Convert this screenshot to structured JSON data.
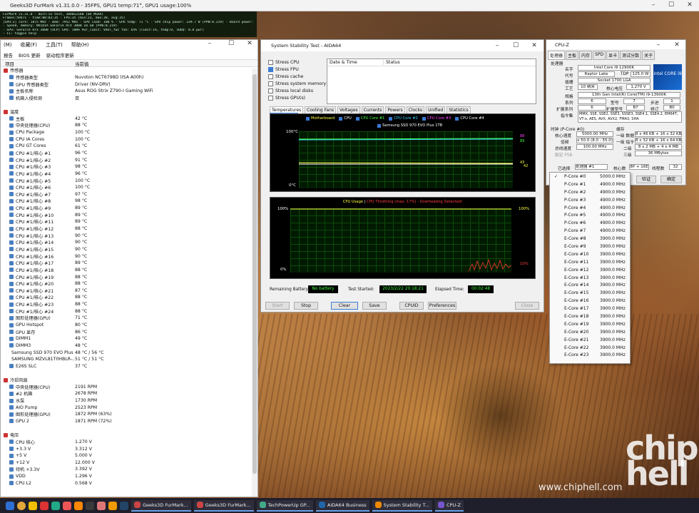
{
  "titlebar": {
    "title": "Geeks3D FurMark v1.31.0.0 - 35FPS, GPU1 temp:71°, GPU1 usage:100%"
  },
  "overlay": {
    "lines": [
      "FurMark v1.31.0 - Burn-in test, 3840x2160 (0X MSAA)",
      "Frames:58471 - time:00:03:35 - FPS:35 (min:23, max:38, avg:35)",
      "[GPU-Z] core: 1875 MHz - mem: 7952 MHz - GPU load: 100 % - GPU temp: 71 °C - GPU chip power: 239.7 W (PPW:0.219) - Board power: 318.4 W (PPW:0.11) - GPU voltage: 0.893 V",
      "- Speed, memory:   NVIDIA GeForce RTX 3080 10 GB (PPW:0.219)",
      "- GPU: GeForce RTX 3080 (OCP) GPU: 100% Pwr_limit: VRel_fwc fan: 65% (limit:1%, temp:0, vDDQ: 0.8 pwr)",
      "- F1: toggle help"
    ]
  },
  "hwinfo": {
    "menu": [
      "(M)",
      "收藏(F)",
      "工具(T)",
      "帮助(H)"
    ],
    "toolbar": [
      "报告",
      "BIOS 更新",
      "驱动程序更新"
    ],
    "col_item": "项目",
    "col_value": "当前值",
    "rows": [
      [
        "传感器",
        ""
      ],
      [
        "传感器类型",
        "Nuvoton NCT6798D (ISA A00h)"
      ],
      [
        "GPU 传感器类型",
        "Driver (NV-DRV)"
      ],
      [
        "主板名称",
        "Asus ROG Strix Z790-I Gaming WiFi"
      ],
      [
        "机箱入侵检测",
        "否"
      ],
      [
        "",
        ""
      ],
      [
        "温度",
        ""
      ],
      [
        "主板",
        "42 °C"
      ],
      [
        "中央处理器(CPU)",
        "88 °C"
      ],
      [
        "CPU Package",
        "100 °C"
      ],
      [
        "CPU IA Cores",
        "100 °C"
      ],
      [
        "CPU GT Cores",
        "61 °C"
      ],
      [
        "CPU #1/核心 #1",
        "96 °C"
      ],
      [
        "CPU #1/核心 #2",
        "91 °C"
      ],
      [
        "CPU #1/核心 #3",
        "98 °C"
      ],
      [
        "CPU #1/核心 #4",
        "96 °C"
      ],
      [
        "CPU #1/核心 #5",
        "100 °C"
      ],
      [
        "CPU #1/核心 #6",
        "100 °C"
      ],
      [
        "CPU #1/核心 #7",
        "97 °C"
      ],
      [
        "CPU #1/核心 #8",
        "98 °C"
      ],
      [
        "CPU #1/核心 #9",
        "89 °C"
      ],
      [
        "CPU #1/核心 #10",
        "89 °C"
      ],
      [
        "CPU #1/核心 #11",
        "89 °C"
      ],
      [
        "CPU #1/核心 #12",
        "88 °C"
      ],
      [
        "CPU #1/核心 #13",
        "90 °C"
      ],
      [
        "CPU #1/核心 #14",
        "90 °C"
      ],
      [
        "CPU #1/核心 #15",
        "90 °C"
      ],
      [
        "CPU #1/核心 #16",
        "90 °C"
      ],
      [
        "CPU #1/核心 #17",
        "89 °C"
      ],
      [
        "CPU #1/核心 #18",
        "88 °C"
      ],
      [
        "CPU #1/核心 #19",
        "88 °C"
      ],
      [
        "CPU #1/核心 #20",
        "88 °C"
      ],
      [
        "CPU #1/核心 #21",
        "87 °C"
      ],
      [
        "CPU #1/核心 #22",
        "88 °C"
      ],
      [
        "CPU #1/核心 #23",
        "88 °C"
      ],
      [
        "CPU #1/核心 #24",
        "88 °C"
      ],
      [
        "图形处理器(GPU)",
        "71 °C"
      ],
      [
        "GPU Hotspot",
        "80 °C"
      ],
      [
        "GPU 显存",
        "86 °C"
      ],
      [
        "DIMM1",
        "49 °C"
      ],
      [
        "DIMM3",
        "48 °C"
      ],
      [
        "Samsung SSD 970 EVO Plus ...",
        "48 °C / 56 °C"
      ],
      [
        "SAMSUNG MZVL81T0HBLR-...",
        "51 °C / 51 °C"
      ],
      [
        "E26S SLC",
        "37 °C"
      ],
      [
        "",
        ""
      ],
      [
        "冷却风扇",
        ""
      ],
      [
        "中央处理器(CPU)",
        "2191 RPM"
      ],
      [
        "#2 机箱",
        "2678 RPM"
      ],
      [
        "水泵",
        "1730 RPM"
      ],
      [
        "AIO Pump",
        "2523 RPM"
      ],
      [
        "图形处理器(GPU)",
        "1872 RPM  (63%)"
      ],
      [
        "GPU 2",
        "1871 RPM  (72%)"
      ],
      [
        "",
        ""
      ],
      [
        "电压",
        ""
      ],
      [
        "CPU 核心",
        "1.270 V"
      ],
      [
        "+3.3 V",
        "3.312 V"
      ],
      [
        "+5 V",
        "5.000 V"
      ],
      [
        "+12 V",
        "12.000 V"
      ],
      [
        "待机 +3.3V",
        "3.392 V"
      ],
      [
        "VDD",
        "1.296 V"
      ],
      [
        "CPU L2",
        "0.568 V"
      ]
    ]
  },
  "aida": {
    "title": "System Stability Test - AIDA64",
    "checks": [
      [
        "Stress CPU",
        false
      ],
      [
        "Stress FPU",
        true
      ],
      [
        "Stress cache",
        false
      ],
      [
        "Stress system memory",
        false
      ],
      [
        "Stress local disks",
        false
      ],
      [
        "Stress GPU(s)",
        false
      ]
    ],
    "log_cols": [
      "Date & Time",
      "Status"
    ],
    "tabs": [
      "Temperatures",
      "Cooling Fans",
      "Voltages",
      "Currents",
      "Powers",
      "Clocks",
      "Unified",
      "Statistics"
    ],
    "legend1": [
      "Motherboard",
      "CPU",
      "CPU Core #1",
      "CPU Core #2",
      "CPU Core #3",
      "CPU Core #4"
    ],
    "legend1_colors": [
      "#ffff40",
      "#ffffff",
      "#40ff40",
      "#40d0ff",
      "#ff40ff",
      "#ffffff"
    ],
    "legend2": "Samsung SSD 970 EVO Plus 1TB",
    "g1_top": "100°C",
    "g1_bot": "0°C",
    "g1_vals": [
      "88",
      "89",
      "43",
      "42"
    ],
    "g1_right": "Crosshair\nPrediction",
    "g2_title": "CPU Usage",
    "g2_sep": "|",
    "g2_title2": "CPU Throttling (max: 17%) - Overheating Detected!",
    "g2_top": "100%",
    "g2_bot": "0%",
    "g2_rtop": "100%",
    "g2_rbot": "10%",
    "battery_label": "Remaining Battery:",
    "battery": "No battery",
    "started_label": "Test Started:",
    "started": "2023/2/22 20:18:21",
    "elapsed_label": "Elapsed Time:",
    "elapsed": "00:02:48",
    "buttons": [
      "Start",
      "Stop",
      "Clear",
      "Save",
      "CPUID",
      "Preferences",
      "Close"
    ]
  },
  "cpuz": {
    "title": "CPU-Z",
    "tabs": [
      "处理器",
      "主板",
      "内存",
      "SPD",
      "显卡",
      "测试分数",
      "关于"
    ],
    "group": "处理器",
    "name_l": "名字",
    "name": "Intel Core i9 12900K",
    "code_l": "代号",
    "code": "Raptor Lake",
    "tdp_l": "TDP",
    "tdp": "125.0 W",
    "sock_l": "插槽",
    "sock": "Socket 1700 LGA",
    "proc_l": "工艺",
    "proc": "10 纳米",
    "volt_l": "核心电压",
    "volt": "1.270 V",
    "spec_l": "规格",
    "spec": "13th Gen Intel(R) Core(TM) i9-13900K",
    "fam_l": "系列",
    "fam": "6",
    "model_l": "型号",
    "model": "7",
    "step_l": "步进",
    "step": "1",
    "efam_l": "扩展系列",
    "efam": "6",
    "emod_l": "扩展型号",
    "emod": "B7",
    "rev_l": "修订",
    "rev": "B0",
    "inst_l": "指令集",
    "inst": "MMX, SSE, SSE2, SSE3, SSSE3, SSE4.1, SSE4.2, EM64T, VT-x, AES, AVX, AVX2, FMA3, SHA",
    "clock_g": "时钟 (P-Core #0)",
    "cache_g": "缓存",
    "cs_l": "核心速度",
    "cs": "5000.00 MHz",
    "mult_l": "倍频",
    "mult": "x 50.0 (8.0 - 55.0)",
    "bus_l": "总线速度",
    "bus": "100.00 MHz",
    "fsb_l": "额定 FSB",
    "l1d_l": "一级 数据",
    "l1d": "8 x 48 KB + 16 x 32 KB",
    "l1i_l": "一级 指令",
    "l1i": "8 x 32 KB + 16 x 64 KB",
    "l2_l": "二级",
    "l2": "8 x 2 MB + 4 x 4 MB",
    "l3_l": "三级",
    "l3": "36 MBytes",
    "sel_l": "已选择",
    "sel": "处理器 #1",
    "cores_l": "核心数",
    "cores": "8P + 16E",
    "thr_l": "线程数",
    "thr": "32",
    "validate": "验证",
    "ok": "确定",
    "logo": "intel CORE i9"
  },
  "coremenu": [
    [
      "P-Core #0",
      "5000.0 MHz"
    ],
    [
      "P-Core #1",
      "4900.0 MHz"
    ],
    [
      "P-Core #2",
      "4900.0 MHz"
    ],
    [
      "P-Core #3",
      "4900.0 MHz"
    ],
    [
      "P-Core #4",
      "4900.0 MHz"
    ],
    [
      "P-Core #5",
      "4900.0 MHz"
    ],
    [
      "P-Core #6",
      "4900.0 MHz"
    ],
    [
      "P-Core #7",
      "4900.0 MHz"
    ],
    [
      "E-Core #8",
      "3900.0 MHz"
    ],
    [
      "E-Core #9",
      "3900.0 MHz"
    ],
    [
      "E-Core #10",
      "3900.0 MHz"
    ],
    [
      "E-Core #11",
      "3900.0 MHz"
    ],
    [
      "E-Core #12",
      "3900.0 MHz"
    ],
    [
      "E-Core #13",
      "3900.0 MHz"
    ],
    [
      "E-Core #14",
      "3900.0 MHz"
    ],
    [
      "E-Core #15",
      "3900.0 MHz"
    ],
    [
      "E-Core #16",
      "3900.0 MHz"
    ],
    [
      "E-Core #17",
      "3900.0 MHz"
    ],
    [
      "E-Core #18",
      "3900.0 MHz"
    ],
    [
      "E-Core #19",
      "3900.0 MHz"
    ],
    [
      "E-Core #20",
      "3900.0 MHz"
    ],
    [
      "E-Core #21",
      "3900.0 MHz"
    ],
    [
      "E-Core #22",
      "3900.0 MHz"
    ],
    [
      "E-Core #23",
      "3900.0 MHz"
    ]
  ],
  "taskbar": [
    "Geeks3D FurMark...",
    "Geeks3D FurMark...",
    "TechPowerUp GP...",
    "AIDA64 Business",
    "System Stability T...",
    "CPU-Z"
  ],
  "logo_text": "chip hell",
  "watermark": "www.chiphell.com"
}
